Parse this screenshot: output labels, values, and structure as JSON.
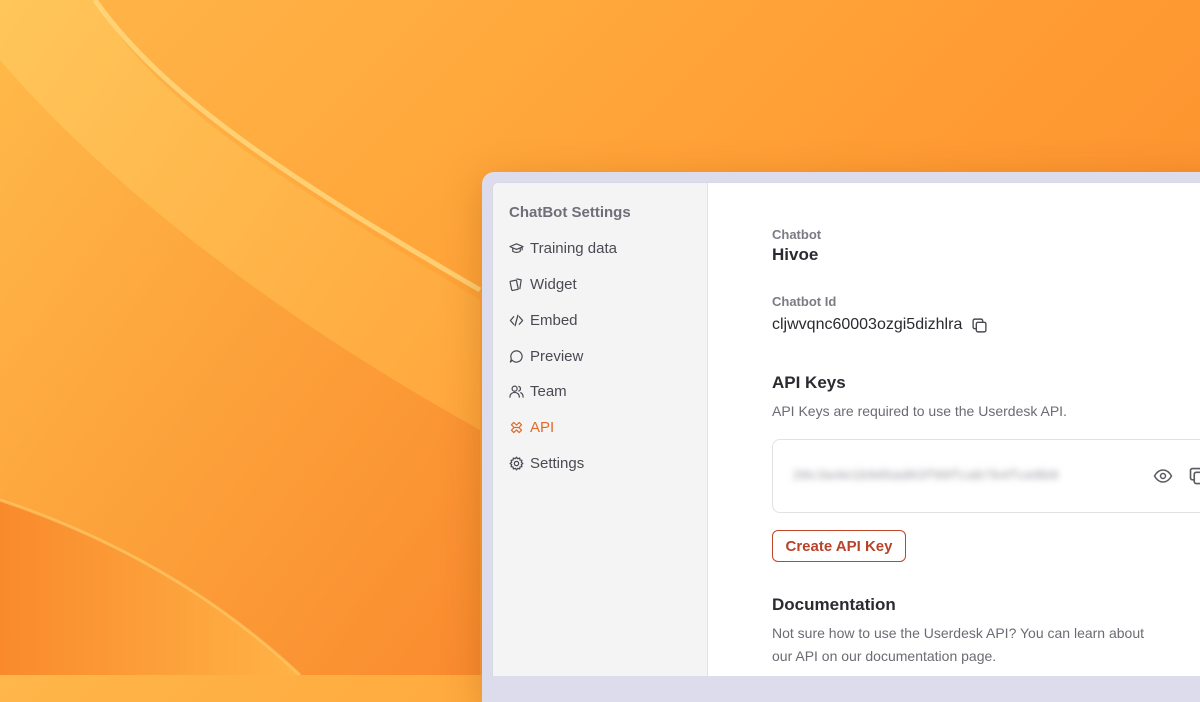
{
  "sidebar": {
    "title": "ChatBot Settings",
    "items": [
      {
        "label": "Training data",
        "icon": "graduation-cap-icon",
        "active": false
      },
      {
        "label": "Widget",
        "icon": "widget-icon",
        "active": false
      },
      {
        "label": "Embed",
        "icon": "code-icon",
        "active": false
      },
      {
        "label": "Preview",
        "icon": "chat-bubble-icon",
        "active": false
      },
      {
        "label": "Team",
        "icon": "users-icon",
        "active": false
      },
      {
        "label": "API",
        "icon": "api-icon",
        "active": true
      },
      {
        "label": "Settings",
        "icon": "gear-icon",
        "active": false
      }
    ]
  },
  "main": {
    "chatbot_label": "Chatbot",
    "chatbot_name": "Hivoe",
    "chatbot_id_label": "Chatbot Id",
    "chatbot_id": "cljwvqnc60003ozgi5dizhlra",
    "api_keys_heading": "API Keys",
    "api_keys_desc": "API Keys are required to use the Userdesk API.",
    "api_key_value": "20c3a4e1b9d5ad63f09fcab7b4fce8b0",
    "create_button": "Create API Key",
    "documentation_heading": "Documentation",
    "documentation_desc_line1": "Not sure how to use the Userdesk API? You can learn about",
    "documentation_desc_line2": "our API on our documentation page."
  },
  "colors": {
    "accent": "#e06a2c",
    "button_border": "#c0462a",
    "wallpaper": "#ffa63a"
  }
}
